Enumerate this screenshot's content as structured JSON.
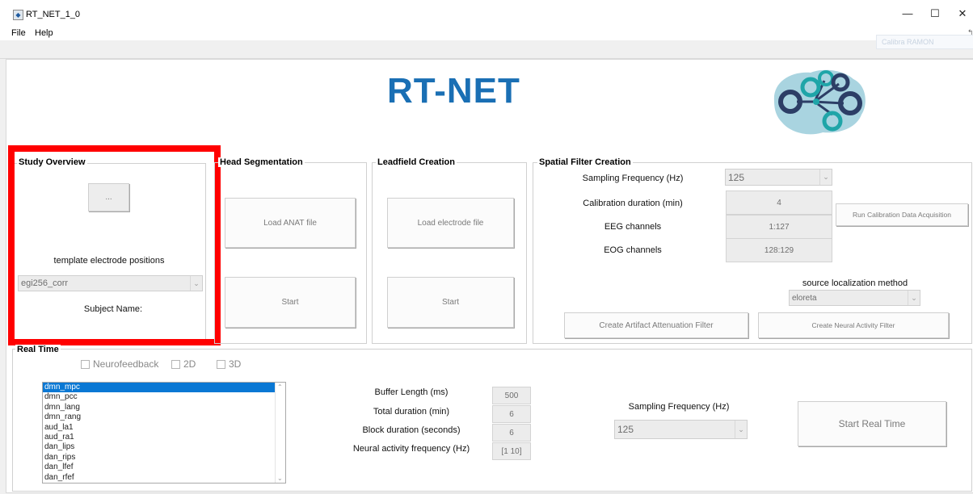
{
  "window": {
    "title": "RT_NET_1_0",
    "minimize": "—",
    "maximize": "☐",
    "close": "✕"
  },
  "menu": {
    "file": "File",
    "help": "Help",
    "arrow": "↰"
  },
  "toolbar": {
    "ghost_label": "Calibra RAMON"
  },
  "app_title": "RT-NET",
  "study": {
    "legend": "Study Overview",
    "browse_button": "...",
    "template_label": "template electrode positions",
    "template_value": "egi256_corr",
    "subject_label": "Subject Name:"
  },
  "head_seg": {
    "legend": "Head Segmentation",
    "load_button": "Load ANAT file",
    "start_button": "Start"
  },
  "leadfield": {
    "legend": "Leadfield Creation",
    "load_button": "Load electrode file",
    "start_button": "Start"
  },
  "spatial": {
    "legend": "Spatial Filter Creation",
    "sampling_label": "Sampling Frequency (Hz)",
    "sampling_value": "125",
    "calibration_label": "Calibration duration (min)",
    "calibration_value": "4",
    "eeg_label": "EEG channels",
    "eeg_value": "1:127",
    "eog_label": "EOG channels",
    "eog_value": "128:129",
    "run_button": "Run Calibration Data Acquisition",
    "source_label": "source localization method",
    "source_value": "eloreta",
    "artifact_button": "Create Artifact Attenuation Filter",
    "neural_button": "Create Neural Activity Filter"
  },
  "realtime": {
    "legend": "Real Time",
    "neurofeedback": "Neurofeedback",
    "two_d": "2D",
    "three_d": "3D",
    "networks": [
      "dmn_mpc",
      "dmn_pcc",
      "dmn_lang",
      "dmn_rang",
      "aud_la1",
      "aud_ra1",
      "dan_lips",
      "dan_rips",
      "dan_lfef",
      "dan_rfef"
    ],
    "buffer_label": "Buffer Length (ms)",
    "buffer_value": "500",
    "total_label": "Total duration (min)",
    "total_value": "6",
    "block_label": "Block duration (seconds)",
    "block_value": "6",
    "neural_freq_label": "Neural activity frequency (Hz)",
    "neural_freq_value": "[1 10]",
    "sampling_label": "Sampling Frequency (Hz)",
    "sampling_value": "125",
    "start_button": "Start Real Time"
  },
  "colors": {
    "title_blue": "#1a6fb4",
    "highlight_red": "#ff0000",
    "selection_blue": "#0a78d4",
    "logo_navy": "#2c3e66",
    "logo_teal": "#1fa5a8",
    "logo_bg": "#a9d4e0"
  }
}
